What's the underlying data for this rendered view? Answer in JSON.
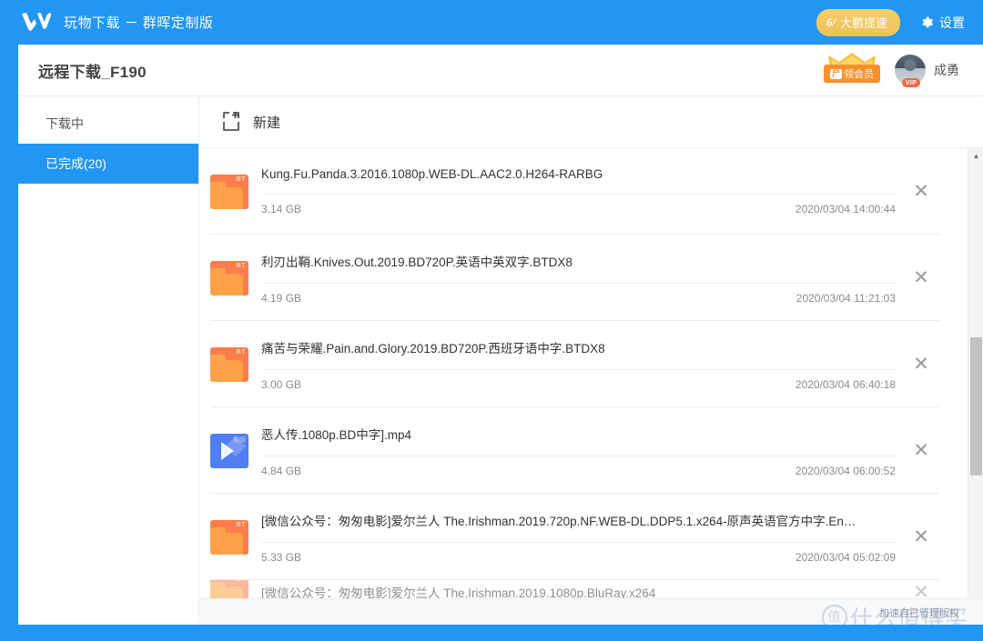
{
  "topbar": {
    "brand_title": "玩物下载 － 群晖定制版",
    "logo_icon": "w-logo-icon",
    "speed_button": {
      "label": "大鹏提速",
      "glyph": "6/",
      "color": "#eec256"
    },
    "settings": {
      "label": "设置",
      "icon": "gear-icon"
    }
  },
  "header": {
    "page_title": "远程下载_F190",
    "vip_badge": {
      "label": "领会员",
      "mark": "尸",
      "crown_icon": "crown-icon",
      "color": "#f8902c"
    },
    "avatar": {
      "vip_tag": "VIP"
    },
    "user_name": "成勇"
  },
  "sidebar": {
    "items": [
      {
        "label": "下载中",
        "active": false
      },
      {
        "label": "已完成(20)",
        "active": true
      }
    ]
  },
  "toolbar": {
    "new_button": {
      "label": "新建",
      "icon": "new-task-icon"
    }
  },
  "list": {
    "close_glyph": "✕",
    "rows": [
      {
        "icon": "bt-folder-icon",
        "icon_tag": "BT",
        "name": "Kung.Fu.Panda.3.2016.1080p.WEB-DL.AAC2.0.H264-RARBG",
        "size": "3.14 GB",
        "time": "2020/03/04 14:00:44"
      },
      {
        "icon": "bt-folder-icon",
        "icon_tag": "BT",
        "name": "利刃出鞘.Knives.Out.2019.BD720P.英语中英双字.BTDX8",
        "size": "4.19 GB",
        "time": "2020/03/04 11:21:03"
      },
      {
        "icon": "bt-folder-icon",
        "icon_tag": "BT",
        "name": "痛苦与荣耀.Pain.and.Glory.2019.BD720P.西班牙语中字.BTDX8",
        "size": "3.00 GB",
        "time": "2020/03/04 06:40:18"
      },
      {
        "icon": "video-file-icon",
        "icon_tag": "视频",
        "name": "恶人传.1080p.BD中字].mp4",
        "size": "4.84 GB",
        "time": "2020/03/04 06:00:52"
      },
      {
        "icon": "bt-folder-icon",
        "icon_tag": "BT",
        "name": "[微信公众号：匆匆电影]爱尔兰人 The.Irishman.2019.720p.NF.WEB-DL.DDP5.1.x264-原声英语官方中字.En…",
        "size": "5.33 GB",
        "time": "2020/03/04 05:02:09"
      },
      {
        "icon": "bt-folder-icon",
        "icon_tag": "BT",
        "name": "[微信公众号：匆匆电影]爱尔兰人 The.Irishman.2019.1080p.BluRay.x264",
        "size": "",
        "time": ""
      }
    ]
  },
  "scrollbar": {
    "up_arrow": "▲",
    "down_arrow": "▼"
  },
  "footer": {
    "note": "加速自己管理版权",
    "watermark": {
      "mark": "值",
      "text": "什么值得买"
    }
  }
}
